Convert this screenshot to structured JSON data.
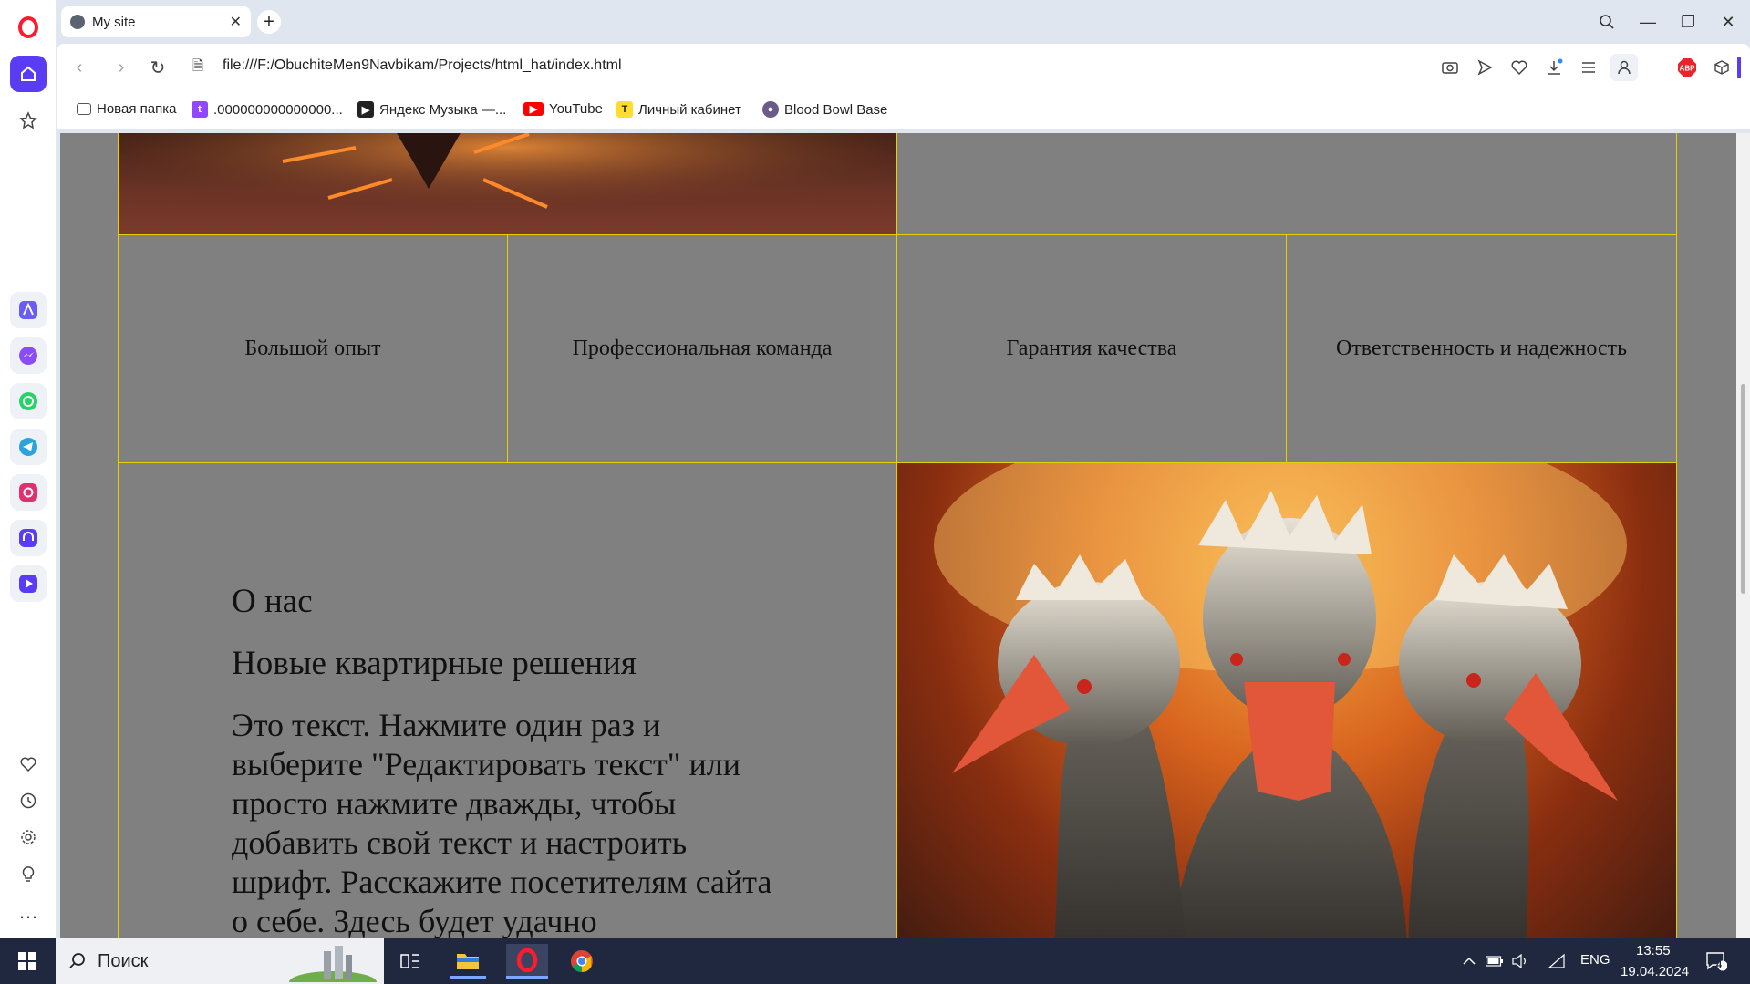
{
  "browser": {
    "tab_title": "My site",
    "url": "file:///F:/ObuchiteMen9Navbikam/Projects/html_hat/index.html"
  },
  "bookmarks": [
    {
      "label": "Новая папка",
      "icon": "folder-icon"
    },
    {
      "label": ".000000000000000...",
      "icon": "twitch-icon"
    },
    {
      "label": "Яндекс Музыка —...",
      "icon": "yandex-music-icon"
    },
    {
      "label": "YouTube",
      "icon": "youtube-icon"
    },
    {
      "label": "Личный кабинет",
      "icon": "t-icon"
    },
    {
      "label": "Blood Bowl Base",
      "icon": "bloodbowl-icon"
    }
  ],
  "page": {
    "features": [
      "Большой опыт",
      "Профессиональная команда",
      "Гарантия качества",
      "Ответственность и надежность"
    ],
    "about": {
      "heading": "О нас",
      "subheading": "Новые квартирные решения",
      "text": "Это текст. Нажмите один раз и выберите \"Редактировать текст\" или просто нажмите дважды, чтобы добавить свой текст и настроить шрифт. Расскажите посетителям сайта о себе. Здесь будет удачно"
    }
  },
  "taskbar": {
    "search_label": "Поиск",
    "language": "ENG",
    "time": "13:55",
    "date": "19.04.2024",
    "notifications_count": "4"
  },
  "extensions": {
    "adblock_label": "ABP"
  },
  "colors": {
    "page_bg": "#808080",
    "grid_border": "#e8d000",
    "opera_red": "#ff1b2d",
    "accent": "#5b3cf5"
  }
}
